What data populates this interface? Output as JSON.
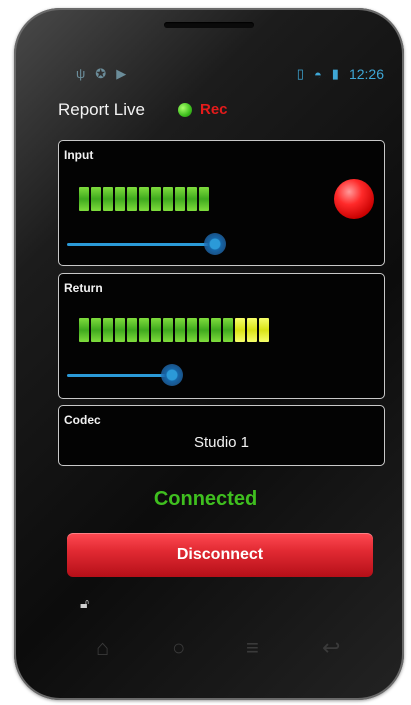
{
  "status_bar": {
    "left_icons": [
      "usb-icon",
      "android-debug-icon",
      "play-icon"
    ],
    "right_icons": [
      "vibrate-icon",
      "wifi-icon",
      "battery-icon"
    ],
    "time": "12:26"
  },
  "app": {
    "title": "Report Live",
    "rec_label": "Rec"
  },
  "input_panel": {
    "label": "Input",
    "meter_green_segments": 11,
    "meter_yellow_segments": 0,
    "slider_level": 0.78
  },
  "return_panel": {
    "label": "Return",
    "meter_green_segments": 13,
    "meter_yellow_segments": 3,
    "slider_level": 0.5
  },
  "codec_panel": {
    "label": "Codec",
    "value": "Studio 1"
  },
  "status_text": "Connected",
  "disconnect_label": "Disconnect",
  "nav_icons": [
    "home-icon",
    "search-icon",
    "menu-icon",
    "back-icon"
  ],
  "colors": {
    "accent_blue": "#2b9ad8",
    "connected_green": "#3fbf1f",
    "rec_red": "#e41b1b",
    "button_red": "#e22a33"
  }
}
